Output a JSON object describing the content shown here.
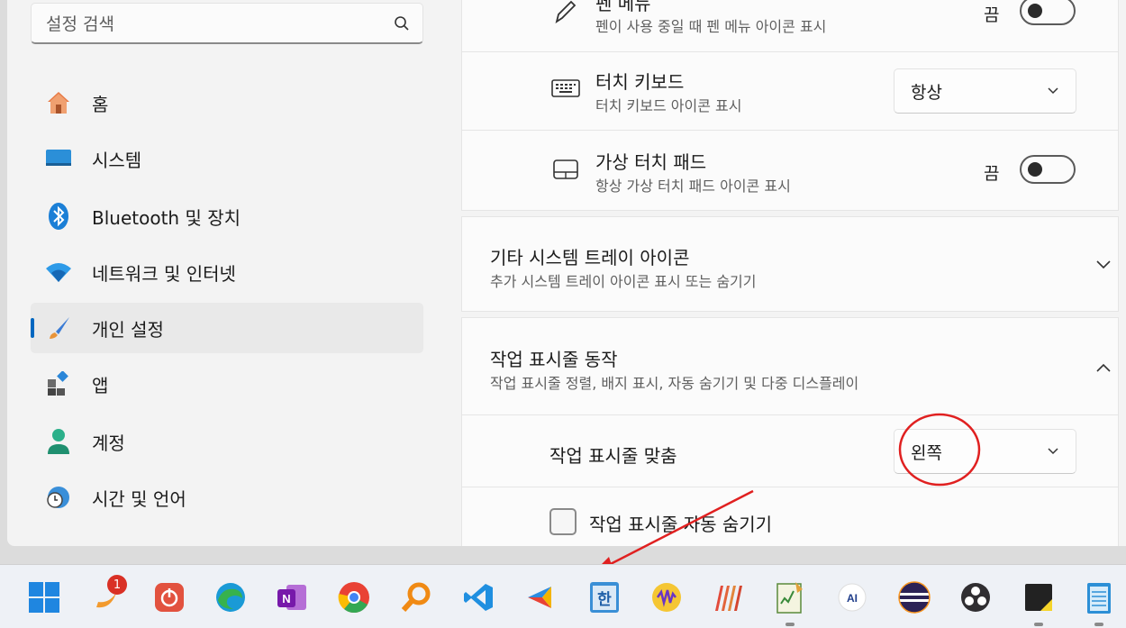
{
  "sidebar": {
    "search_placeholder": "설정 검색",
    "items": [
      {
        "label": "홈"
      },
      {
        "label": "시스템"
      },
      {
        "label": "Bluetooth 및 장치"
      },
      {
        "label": "네트워크 및 인터넷"
      },
      {
        "label": "개인 설정",
        "selected": true
      },
      {
        "label": "앱"
      },
      {
        "label": "계정"
      },
      {
        "label": "시간 및 언어"
      }
    ]
  },
  "content": {
    "pen_menu": {
      "title": "펜 메뉴",
      "subtitle": "펜이 사용 중일 때 펜 메뉴 아이콘 표시",
      "state_label": "끔"
    },
    "touch_keyboard": {
      "title": "터치 키보드",
      "subtitle": "터치 키보드 아이콘 표시",
      "value": "항상"
    },
    "virtual_touchpad": {
      "title": "가상 터치 패드",
      "subtitle": "항상 가상 터치 패드 아이콘 표시",
      "state_label": "끔"
    },
    "other_tray": {
      "title": "기타 시스템 트레이 아이콘",
      "subtitle": "추가 시스템 트레이 아이콘 표시 또는 숨기기"
    },
    "taskbar_behaviors": {
      "title": "작업 표시줄 동작",
      "subtitle": "작업 표시줄 정렬, 배지 표시, 자동 숨기기 및 다중 디스플레이"
    },
    "alignment": {
      "label": "작업 표시줄 맞춤",
      "value": "왼쪽"
    },
    "auto_hide": {
      "label": "작업 표시줄 자동 숨기기"
    }
  },
  "taskbar": {
    "badge_count": "1",
    "icons": [
      "start-icon",
      "app-badge-icon",
      "power-app-icon",
      "edge-icon",
      "onenote-icon",
      "chrome-icon",
      "search-magnifier-icon",
      "vscode-icon",
      "arrow-app-icon",
      "hangul-icon",
      "audio-app-icon",
      "stripes-app-icon",
      "notepad-icon",
      "ai-app-icon",
      "eclipse-icon",
      "obs-icon",
      "sticky-notes-icon",
      "notes-icon"
    ]
  },
  "colors": {
    "accent": "#0067c0",
    "annotation": "#e02020"
  }
}
